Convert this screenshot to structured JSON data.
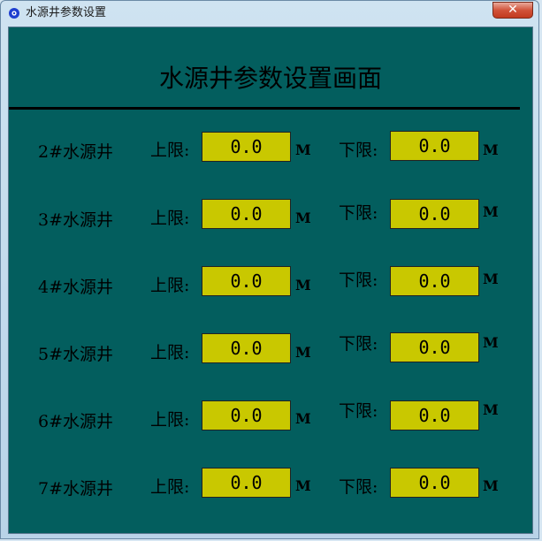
{
  "window": {
    "title": "水源井参数设置",
    "close_label": "✕"
  },
  "page": {
    "heading": "水源井参数设置画面"
  },
  "labels": {
    "upper": "上限:",
    "lower": "下限:",
    "unit": "M"
  },
  "colors": {
    "background": "#035e5e",
    "field": "#c9c800"
  },
  "wells": [
    {
      "name": "2#水源井",
      "upper": "0.0",
      "lower": "0.0"
    },
    {
      "name": "3#水源井",
      "upper": "0.0",
      "lower": "0.0"
    },
    {
      "name": "4#水源井",
      "upper": "0.0",
      "lower": "0.0"
    },
    {
      "name": "5#水源井",
      "upper": "0.0",
      "lower": "0.0"
    },
    {
      "name": "6#水源井",
      "upper": "0.0",
      "lower": "0.0"
    },
    {
      "name": "7#水源井",
      "upper": "0.0",
      "lower": "0.0"
    }
  ]
}
